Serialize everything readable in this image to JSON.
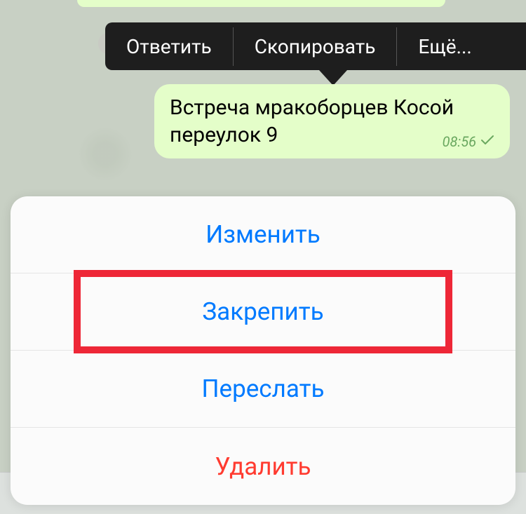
{
  "context_menu": {
    "reply": "Ответить",
    "copy": "Скопировать",
    "more": "Ещё..."
  },
  "message": {
    "text": "Встреча мракоборцев Косой переулок 9",
    "time": "08:56"
  },
  "action_sheet": {
    "edit": "Изменить",
    "pin": "Закрепить",
    "forward": "Переслать",
    "delete": "Удалить"
  }
}
